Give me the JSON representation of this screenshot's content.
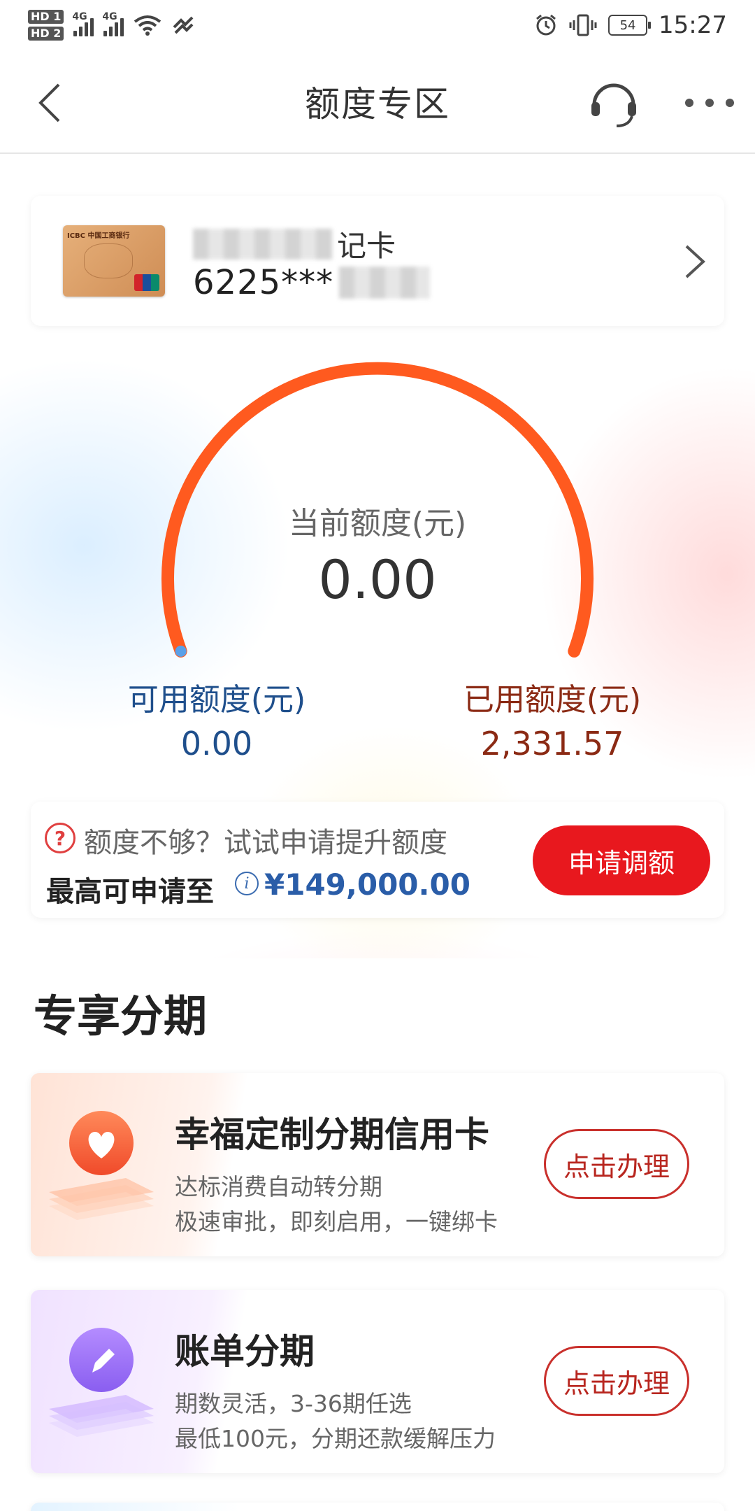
{
  "status_bar": {
    "sim1": "HD 1",
    "sim2": "HD 2",
    "net1": "4G",
    "net2": "4G",
    "battery": "54",
    "time": "15:27"
  },
  "nav": {
    "title": "额度专区",
    "icons": [
      "back-icon",
      "customer-service-icon",
      "more-icon"
    ]
  },
  "card": {
    "name_suffix": "记卡",
    "number_prefix": "6225***",
    "bank_logo_text": "ICBC 中国工商银行"
  },
  "gauge": {
    "label": "当前额度(元)",
    "value": "0.00",
    "available_label": "可用额度(元)",
    "available_value": "0.00",
    "used_label": "已用额度(元)",
    "used_value": "2,331.57",
    "arc_color": "#ff5a1f",
    "marker_color": "#5aa0e8"
  },
  "raise": {
    "hint": "额度不够？试试申请提升额度",
    "max_label": "最高可申请至",
    "max_amount": "¥149,000.00",
    "button": "申请调额"
  },
  "section": {
    "title": "专享分期"
  },
  "promos": [
    {
      "title": "幸福定制分期信用卡",
      "line1": "达标消费自动转分期",
      "line2": "极速审批，即刻启用，一键绑卡",
      "button": "点击办理",
      "icon": "heart-icon"
    },
    {
      "title": "账单分期",
      "line1": "期数灵活，3-36期任选",
      "line2": "最低100元，分期还款缓解压力",
      "button": "点击办理",
      "icon": "pencil-icon"
    }
  ],
  "colors": {
    "primary_red": "#e8181e",
    "link_blue": "#2a5da8"
  }
}
